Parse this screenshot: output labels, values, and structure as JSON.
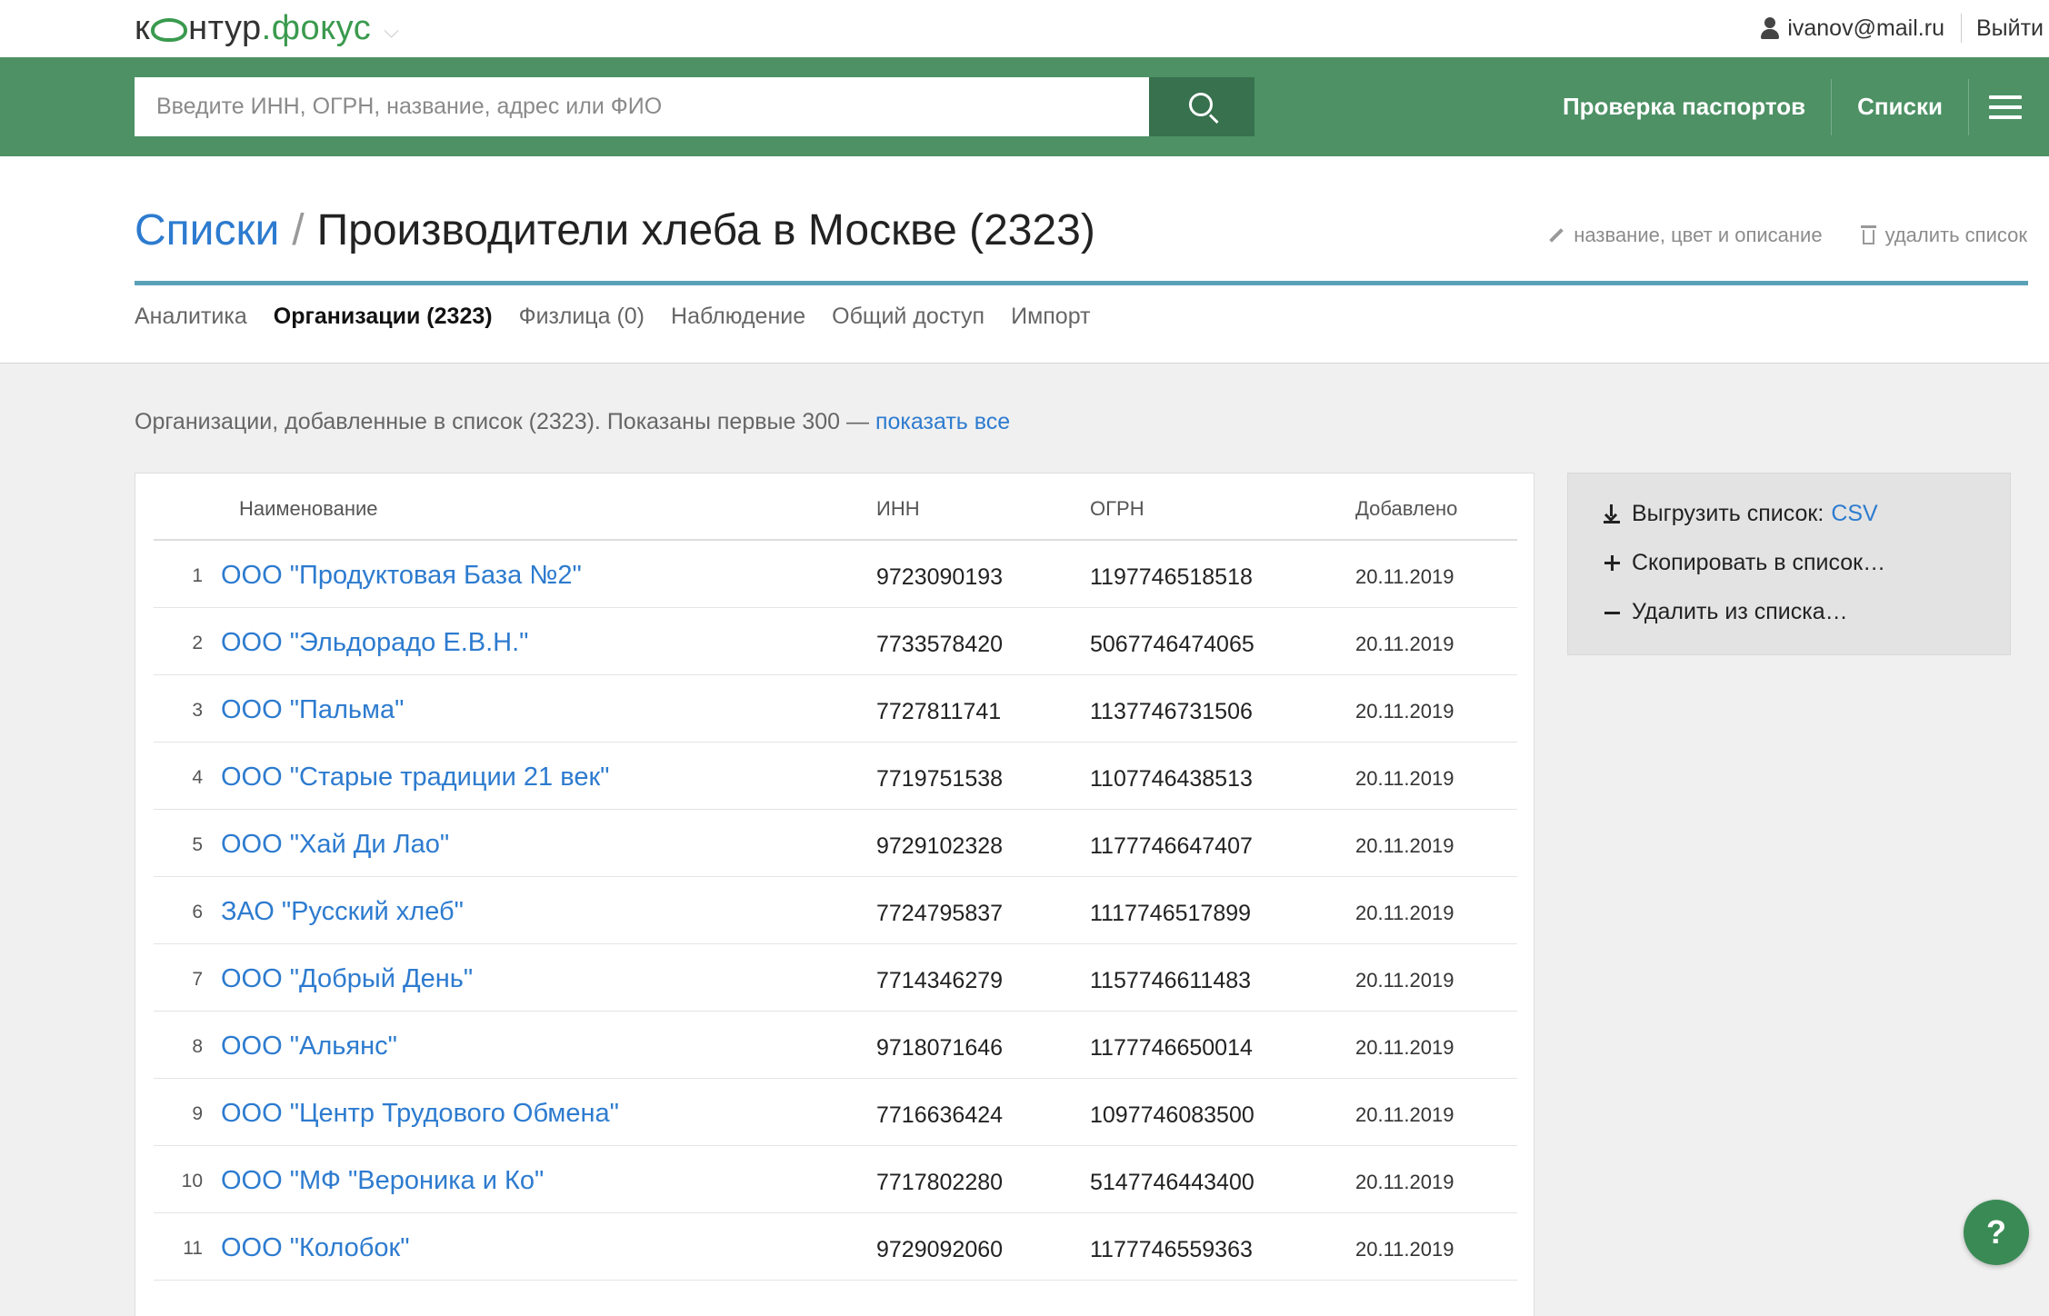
{
  "brand": {
    "logo_k": "к",
    "logo_rest": "нтур",
    "logo_dot": ".",
    "logo_fokus": "фокус",
    "chevron": "⌵"
  },
  "user": {
    "email": "ivanov@mail.ru",
    "logout_label": "Выйти"
  },
  "search": {
    "placeholder": "Введите ИНН, ОГРН, название, адрес или ФИО",
    "value": ""
  },
  "nav": {
    "passport_check": "Проверка паспортов",
    "lists": "Списки"
  },
  "header": {
    "breadcrumb_root": "Списки",
    "separator": "/",
    "title": "Производители хлеба в Москве (2323)",
    "edit_action": "название, цвет и описание",
    "delete_action": "удалить список"
  },
  "tabs": [
    {
      "label": "Аналитика",
      "active": false
    },
    {
      "label": "Организации (2323)",
      "active": true
    },
    {
      "label": "Физлица (0)",
      "active": false
    },
    {
      "label": "Наблюдение",
      "active": false
    },
    {
      "label": "Общий доступ",
      "active": false
    },
    {
      "label": "Импорт",
      "active": false
    }
  ],
  "info": {
    "text": "Организации, добавленные в список (2323). Показаны первые 300 — ",
    "show_all_link": "показать все"
  },
  "table": {
    "columns": {
      "name": "Наименование",
      "inn": "ИНН",
      "ogrn": "ОГРН",
      "added": "Добавлено"
    },
    "rows": [
      {
        "num": "1",
        "name": "ООО \"Продуктовая База №2\"",
        "inn": "9723090193",
        "ogrn": "1197746518518",
        "date": "20.11.2019"
      },
      {
        "num": "2",
        "name": "ООО \"Эльдорадо Е.В.Н.\"",
        "inn": "7733578420",
        "ogrn": "5067746474065",
        "date": "20.11.2019"
      },
      {
        "num": "3",
        "name": "ООО \"Пальма\"",
        "inn": "7727811741",
        "ogrn": "1137746731506",
        "date": "20.11.2019"
      },
      {
        "num": "4",
        "name": "ООО \"Старые традиции 21 век\"",
        "inn": "7719751538",
        "ogrn": "1107746438513",
        "date": "20.11.2019"
      },
      {
        "num": "5",
        "name": "ООО \"Хай Ди Лао\"",
        "inn": "9729102328",
        "ogrn": "1177746647407",
        "date": "20.11.2019"
      },
      {
        "num": "6",
        "name": "ЗАО \"Русский хлеб\"",
        "inn": "7724795837",
        "ogrn": "1117746517899",
        "date": "20.11.2019"
      },
      {
        "num": "7",
        "name": "ООО \"Добрый День\"",
        "inn": "7714346279",
        "ogrn": "1157746611483",
        "date": "20.11.2019"
      },
      {
        "num": "8",
        "name": "ООО \"Альянс\"",
        "inn": "9718071646",
        "ogrn": "1177746650014",
        "date": "20.11.2019"
      },
      {
        "num": "9",
        "name": "ООО \"Центр Трудового Обмена\"",
        "inn": "7716636424",
        "ogrn": "1097746083500",
        "date": "20.11.2019"
      },
      {
        "num": "10",
        "name": "ООО \"МФ \"Вероника и Ко\"",
        "inn": "7717802280",
        "ogrn": "5147746443400",
        "date": "20.11.2019"
      },
      {
        "num": "11",
        "name": "ООО \"Колобок\"",
        "inn": "9729092060",
        "ogrn": "1177746559363",
        "date": "20.11.2019"
      }
    ]
  },
  "side_panel": {
    "export_label": "Выгрузить список:",
    "export_format": "CSV",
    "copy_label": "Скопировать в список…",
    "remove_label": "Удалить из списка…"
  },
  "help": {
    "label": "?"
  }
}
